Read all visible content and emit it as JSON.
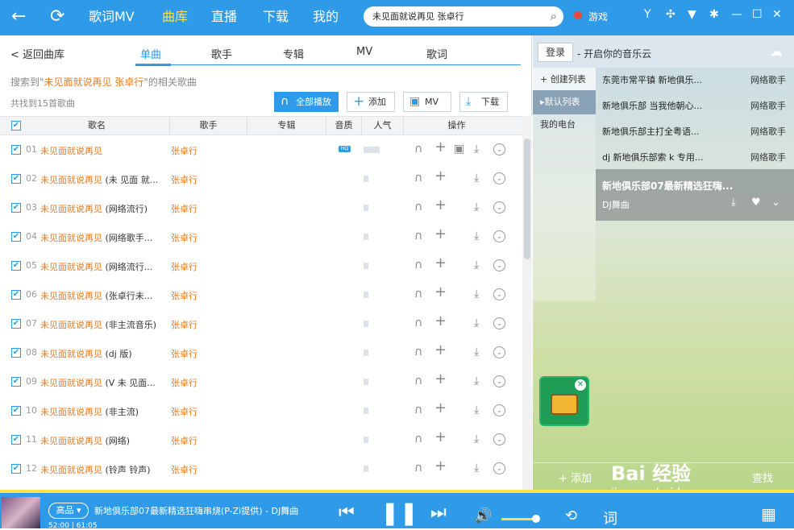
{
  "topbar": {
    "back_icon": "←",
    "refresh_icon": "⟳",
    "nav": [
      "歌词MV",
      "曲库",
      "直播",
      "下载",
      "我的"
    ],
    "active_nav": "曲库",
    "search_value": "未见面就说再见  张卓行",
    "game_label": "游戏"
  },
  "tabs": {
    "back": "< 返回曲库",
    "items": [
      "单曲",
      "歌手",
      "专辑",
      "MV",
      "歌词"
    ],
    "active": "单曲"
  },
  "search_info": {
    "prefix": "搜索到\"",
    "keyword": "未见面就说再见  张卓行",
    "suffix": "\"的相关歌曲",
    "count_text": "共找到15首歌曲"
  },
  "actions": {
    "play_all": "全部播放",
    "add": "添加",
    "mv": "MV",
    "download": "下载"
  },
  "table": {
    "headers": {
      "name": "歌名",
      "artist": "歌手",
      "album": "专辑",
      "quality": "音质",
      "popularity": "人气",
      "ops": "操作"
    },
    "rows": [
      {
        "num": "01",
        "title": "未见面就说再见",
        "extra": "",
        "artist": "张卓行",
        "hq": "HQ",
        "mv": true,
        "pop": 0.7
      },
      {
        "num": "02",
        "title": "未见面就说再见",
        "extra": " (未 见面 就...",
        "artist": "张卓行",
        "hq": "",
        "mv": false,
        "pop": 0.2
      },
      {
        "num": "03",
        "title": "未见面就说再见",
        "extra": " (网络流行)",
        "artist": "张卓行",
        "hq": "",
        "mv": false,
        "pop": 0.2
      },
      {
        "num": "04",
        "title": "未见面就说再见",
        "extra": " (网络歌手...",
        "artist": "张卓行",
        "hq": "",
        "mv": false,
        "pop": 0.2
      },
      {
        "num": "05",
        "title": "未见面就说再见",
        "extra": " (网络流行...",
        "artist": "张卓行",
        "hq": "",
        "mv": false,
        "pop": 0.2
      },
      {
        "num": "06",
        "title": "未见面就说再见",
        "extra": " (张卓行未...",
        "artist": "张卓行",
        "hq": "",
        "mv": false,
        "pop": 0.2
      },
      {
        "num": "07",
        "title": "未见面就说再见",
        "extra": " (非主流音乐)",
        "artist": "张卓行",
        "hq": "",
        "mv": false,
        "pop": 0.2
      },
      {
        "num": "08",
        "title": "未见面就说再见",
        "extra": " (dj 版)",
        "artist": "张卓行",
        "hq": "",
        "mv": false,
        "pop": 0.2
      },
      {
        "num": "09",
        "title": "未见面就说再见",
        "extra": " (V 未 见面...",
        "artist": "张卓行",
        "hq": "",
        "mv": false,
        "pop": 0.2
      },
      {
        "num": "10",
        "title": "未见面就说再见",
        "extra": " (非主流)",
        "artist": "张卓行",
        "hq": "",
        "mv": false,
        "pop": 0.2
      },
      {
        "num": "11",
        "title": "未见面就说再见",
        "extra": " (网络)",
        "artist": "张卓行",
        "hq": "",
        "mv": false,
        "pop": 0.2
      },
      {
        "num": "12",
        "title": "未见面就说再见",
        "extra": " (铃声 铃声)",
        "artist": "张卓行",
        "hq": "",
        "mv": false,
        "pop": 0.2
      }
    ]
  },
  "right_panel": {
    "login": "登录",
    "slogan": "- 开启你的音乐云",
    "lists": [
      "+ 创建列表",
      "默认列表",
      "我的电台"
    ],
    "tracks": [
      {
        "title": "东莞市常平镇  新地俱乐...",
        "artist": "网络歌手"
      },
      {
        "title": "新地俱乐部  当我他朝心...",
        "artist": "网络歌手"
      },
      {
        "title": "新地俱乐部主打全粤语...",
        "artist": "网络歌手"
      },
      {
        "title": "dj 新地俱乐部索 k 专用...",
        "artist": "网络歌手"
      }
    ],
    "selected": {
      "title": "新地俱乐部07最新精选狂嗨...",
      "artist": "DJ舞曲"
    },
    "bottom_add": "添加",
    "bottom_find": "查找"
  },
  "watermark": {
    "line1": "Bai 经验",
    "line2": "jingyan.baidu.com"
  },
  "player": {
    "quality": "高品 ▾",
    "now_playing": "新地俱乐部07最新精选狂嗨串烧(P-Zi提供) - DJ舞曲",
    "time": "52:00 | 61:05",
    "lyrics_btn": "词",
    "progress": 0.85,
    "volume": 0.8
  }
}
